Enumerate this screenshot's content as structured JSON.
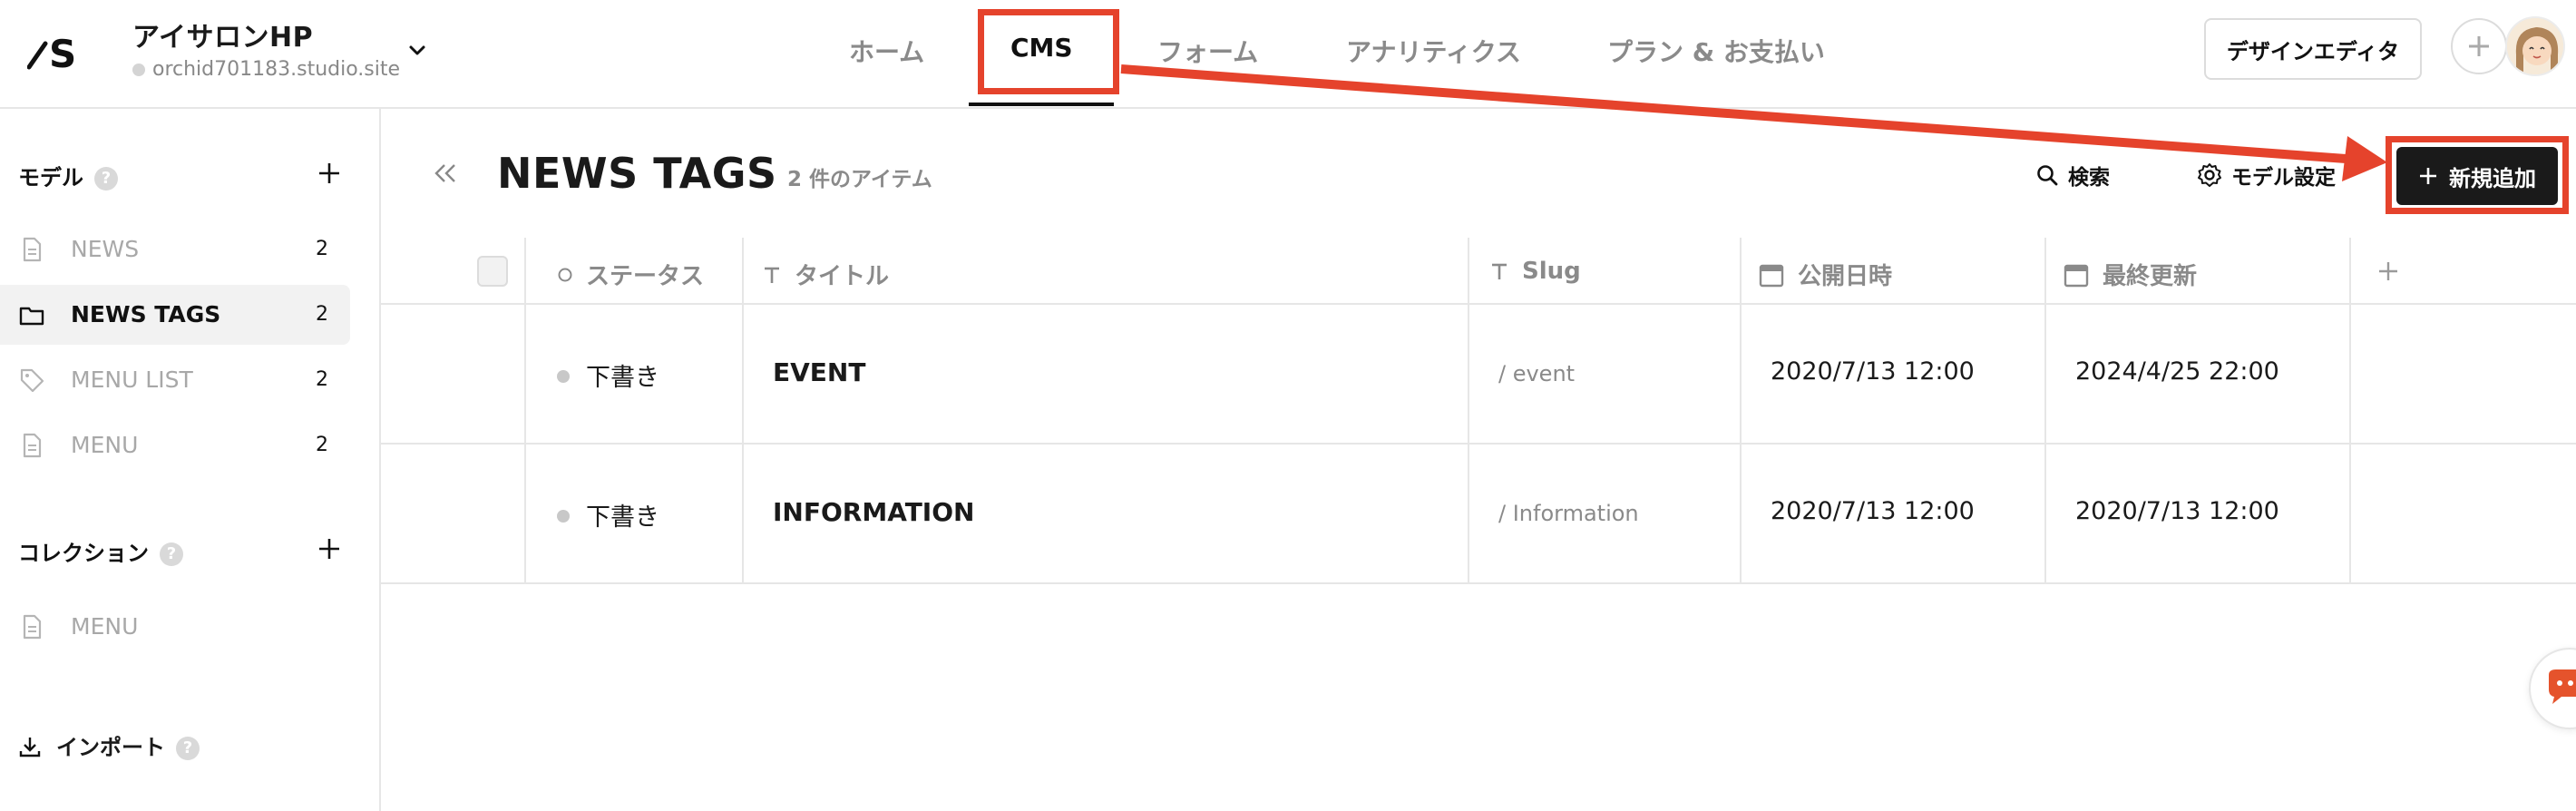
{
  "header": {
    "project_title": "アイサロンHP",
    "project_domain": "orchid701183.studio.site",
    "nav": [
      "ホーム",
      "CMS",
      "フォーム",
      "アナリティクス",
      "プラン & お支払い"
    ],
    "active_nav": "CMS",
    "design_editor_label": "デザインエディタ"
  },
  "sidebar": {
    "models_heading": "モデル",
    "models": [
      {
        "label": "NEWS",
        "count": "2",
        "icon": "document-icon"
      },
      {
        "label": "NEWS TAGS",
        "count": "2",
        "icon": "folder-icon"
      },
      {
        "label": "MENU LIST",
        "count": "2",
        "icon": "tag-icon"
      },
      {
        "label": "MENU",
        "count": "2",
        "icon": "document-icon"
      }
    ],
    "collections_heading": "コレクション",
    "collections": [
      {
        "label": "MENU",
        "icon": "document-icon"
      }
    ],
    "import_label": "インポート",
    "help_glyph": "?"
  },
  "main": {
    "title": "NEWS TAGS",
    "item_count": "2 件のアイテム",
    "search_label": "検索",
    "model_settings_label": "モデル設定",
    "add_new_label": "新規追加"
  },
  "table": {
    "columns": [
      "ステータス",
      "タイトル",
      "Slug",
      "公開日時",
      "最終更新"
    ],
    "rows": [
      {
        "status": "下書き",
        "title": "EVENT",
        "slug": "/ event",
        "published": "2020/7/13 12:00",
        "updated": "2024/4/25 22:00"
      },
      {
        "status": "下書き",
        "title": "INFORMATION",
        "slug": "/ Information",
        "published": "2020/7/13 12:00",
        "updated": "2020/7/13 12:00"
      }
    ]
  },
  "colors": {
    "highlight": "#e5432c",
    "primary_button": "#1a1a1a",
    "muted_text": "#8a8a8a",
    "border": "#e6e6e6"
  }
}
